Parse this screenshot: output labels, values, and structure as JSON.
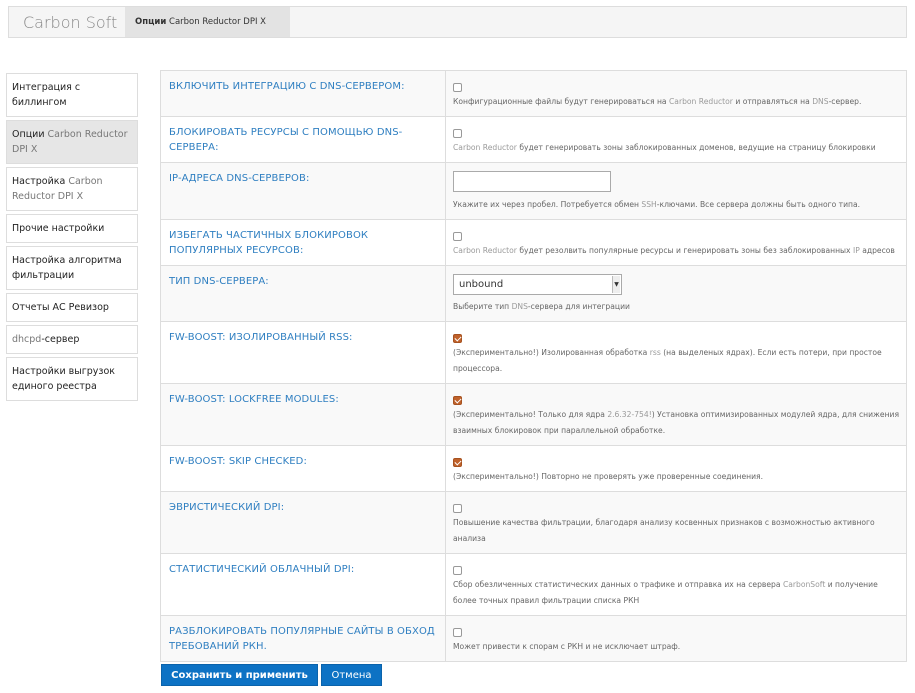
{
  "header": {
    "brand": "Carbon Soft",
    "tab_bold": "Опции",
    "tab_rest": " Carbon Reductor DPI X"
  },
  "sidebar": {
    "items": [
      {
        "label": "Интеграция с биллингом"
      },
      {
        "label_a": "Опции",
        "label_b": " Carbon Reductor DPI X"
      },
      {
        "label_a": "Настройка",
        "label_b": " Carbon Reductor DPI X"
      },
      {
        "label": "Прочие настройки"
      },
      {
        "label": "Настройка алгоритма фильтрации"
      },
      {
        "label": "Отчеты АС Ревизор"
      },
      {
        "label_a": "dhcpd",
        "label_b": "-сервер"
      },
      {
        "label": "Настройки выгрузок единого реестра"
      }
    ]
  },
  "rows": [
    {
      "label": "Включить интеграцию с DNS-сервером:",
      "checked": false,
      "desc": [
        "Конфигурационные файлы будут генерироваться на ",
        "Carbon Reductor",
        " и отправляться на ",
        "DNS",
        "-сервер."
      ]
    },
    {
      "label": "Блокировать ресурсы с помощью DNS-сервера:",
      "checked": false,
      "desc": [
        "",
        "Carbon Reductor",
        " будет генерировать зоны заблокированных доменов, ведущие на страницу блокировки"
      ]
    },
    {
      "label": "IP-адреса DNS-серверов:",
      "input_value": "",
      "desc": [
        "Укажите их через пробел. Потребуется обмен ",
        "SSH",
        "-ключами. Все сервера должны быть одного типа."
      ]
    },
    {
      "label": "Избегать частичных блокировок популярных ресурсов:",
      "checked": false,
      "desc": [
        "",
        "Carbon Reductor",
        " будет резолвить популярные ресурсы и генерировать зоны без заблокированных ",
        "IP",
        " адресов"
      ]
    },
    {
      "label": "Тип DNS-сервера:",
      "select_value": "unbound",
      "desc": [
        "Выберите тип ",
        "DNS",
        "-сервера для интеграции"
      ]
    },
    {
      "label": "FW-BOOST: Изолированный RSS:",
      "checked": true,
      "desc": [
        "(Экспериментально!) Изолированная обработка ",
        "rss",
        " (на выделеных ядрах). Если есть потери, при простое процессора."
      ]
    },
    {
      "label": "FW-BOOST: LOCKFREE MODULES:",
      "checked": true,
      "desc": [
        "(Экспериментально! Только для ядра ",
        "2.6.32-754!",
        ") Установка оптимизированных модулей ядра, для снижения взаимных блокировок при параллельной обработке."
      ]
    },
    {
      "label": "FW-BOOST: SKIP CHECKED:",
      "checked": true,
      "desc": [
        "(Экспериментально!) Повторно не проверять уже проверенные соединения."
      ]
    },
    {
      "label": "Эвристический DPI:",
      "checked": false,
      "desc": [
        "Повышение качества фильтрации, благодаря анализу косвенных признаков с возможностью активного анализа"
      ]
    },
    {
      "label": "Статистический облачный DPI:",
      "checked": false,
      "desc": [
        "Сбор обезличенных статистических данных о трафике и отправка их на сервера ",
        "CarbonSoft",
        " и получение более точных правил фильтрации списка РКН"
      ]
    },
    {
      "label": "Разблокировать популярные сайты в обход требований РКН.",
      "checked": false,
      "desc": [
        "Может привести к спорам с РКН и не исключает штраф."
      ]
    }
  ],
  "buttons": {
    "save": "Сохранить и применить",
    "cancel": "Отмена"
  },
  "colors": {
    "accent": "#0d72c4",
    "label_blue": "#2f7fc1",
    "checkbox_checked": "#c0622b"
  }
}
